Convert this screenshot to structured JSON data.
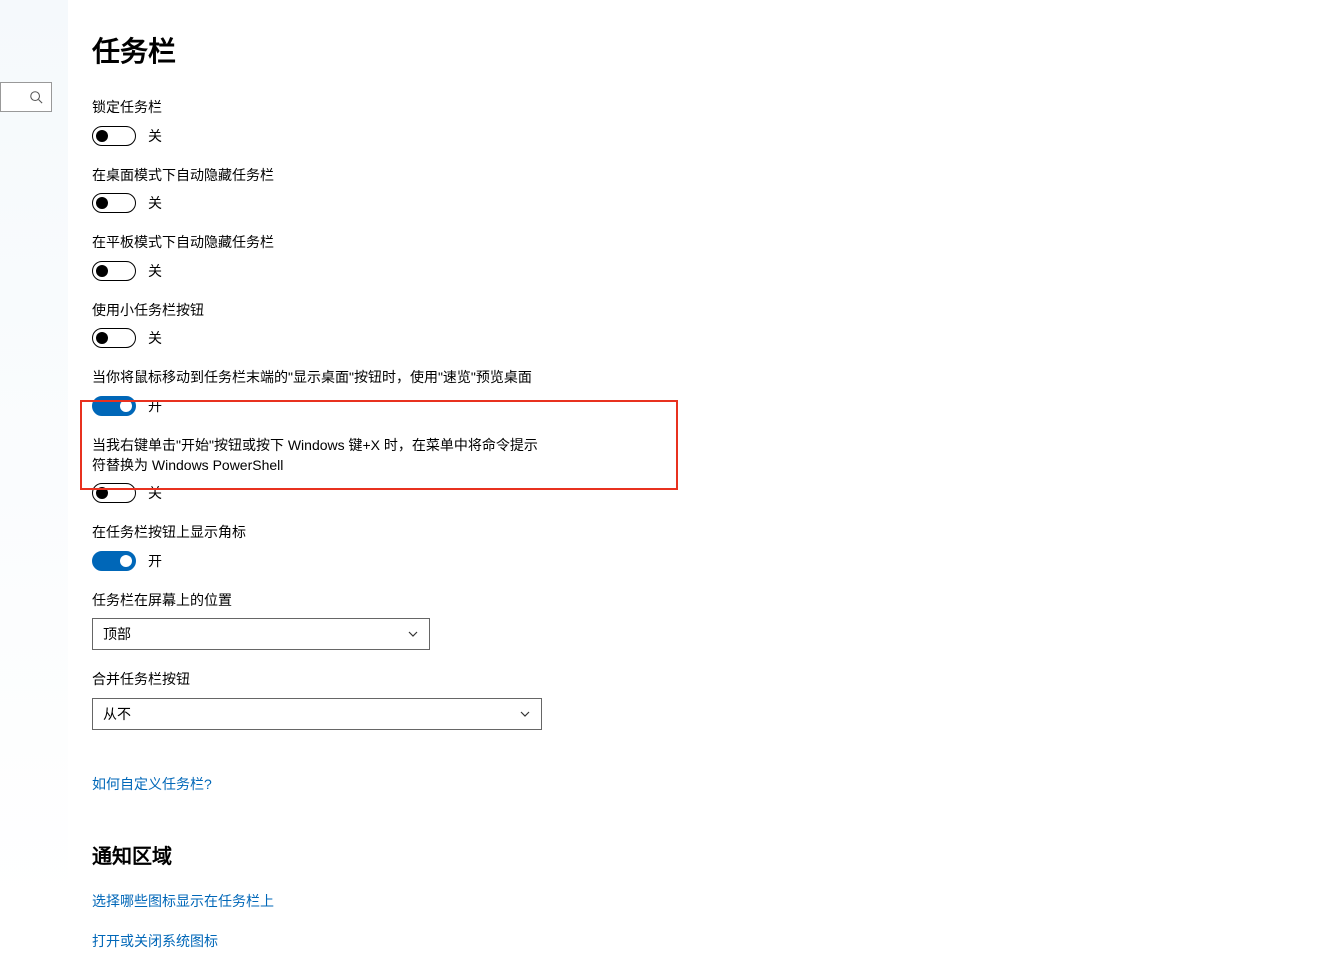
{
  "page": {
    "title": "任务栏"
  },
  "settings": {
    "lock": {
      "label": "锁定任务栏",
      "state": "关",
      "on": false
    },
    "autohide_desktop": {
      "label": "在桌面模式下自动隐藏任务栏",
      "state": "关",
      "on": false
    },
    "autohide_tablet": {
      "label": "在平板模式下自动隐藏任务栏",
      "state": "关",
      "on": false
    },
    "small_buttons": {
      "label": "使用小任务栏按钮",
      "state": "关",
      "on": false
    },
    "peek": {
      "label": "当你将鼠标移动到任务栏末端的\"显示桌面\"按钮时，使用\"速览\"预览桌面",
      "state": "开",
      "on": true
    },
    "powershell": {
      "label": "当我右键单击\"开始\"按钮或按下 Windows 键+X 时，在菜单中将命令提示符替换为 Windows PowerShell",
      "state": "关",
      "on": false
    },
    "badges": {
      "label": "在任务栏按钮上显示角标",
      "state": "开",
      "on": true
    },
    "position": {
      "label": "任务栏在屏幕上的位置",
      "value": "顶部"
    },
    "combine": {
      "label": "合并任务栏按钮",
      "value": "从不"
    }
  },
  "links": {
    "customize": "如何自定义任务栏?"
  },
  "notification": {
    "heading": "通知区域",
    "select_icons": "选择哪些图标显示在任务栏上",
    "system_icons": "打开或关闭系统图标"
  }
}
